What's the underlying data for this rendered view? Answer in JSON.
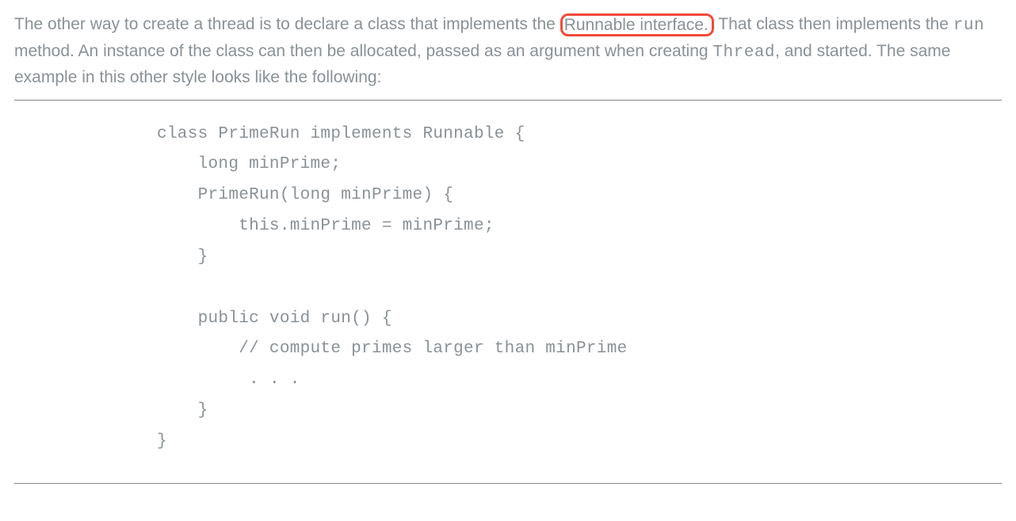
{
  "description": {
    "part1": "The other way to create a thread is to declare a class that implements the ",
    "highlighted": "Runnable interface.",
    "part2": " That class then implements the ",
    "code_word": "run",
    "part3": " method. An instance of the class can then be allocated, passed as an argument when creating ",
    "code_word2": "Thread",
    "part4": ", and started. The same example in this other style looks like the following:"
  },
  "code": "class PrimeRun implements Runnable {\n    long minPrime;\n    PrimeRun(long minPrime) {\n        this.minPrime = minPrime;\n    }\n\n    public void run() {\n        // compute primes larger than minPrime\n         . . .\n    }\n}"
}
